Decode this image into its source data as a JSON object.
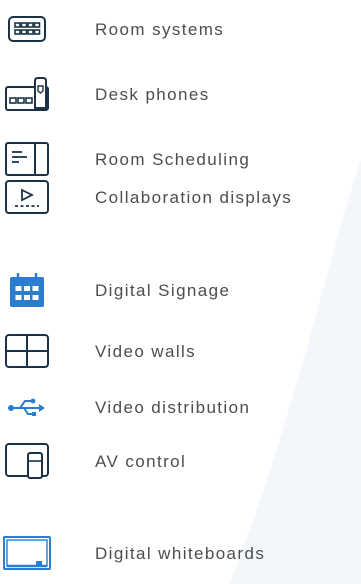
{
  "colors": {
    "icon_stroke": "#1c3347",
    "icon_blue": "#2a7dd1",
    "label_text": "#4d4d4d",
    "background_shape": "#f3f6fa"
  },
  "items": [
    {
      "icon": "room-systems-icon",
      "label": "Room systems"
    },
    {
      "icon": "desk-phone-icon",
      "label": "Desk phones"
    },
    {
      "icon": "room-scheduling-icon",
      "label": "Room Scheduling"
    },
    {
      "icon": "collaboration-display-icon",
      "label": "Collaboration displays"
    },
    {
      "icon": "calendar-grid-icon",
      "label": "Digital Signage"
    },
    {
      "icon": "video-wall-icon",
      "label": "Video walls"
    },
    {
      "icon": "usb-icon",
      "label": "Video distribution"
    },
    {
      "icon": "av-control-icon",
      "label": "AV control"
    },
    {
      "icon": "whiteboard-icon",
      "label": "Digital whiteboards"
    }
  ]
}
